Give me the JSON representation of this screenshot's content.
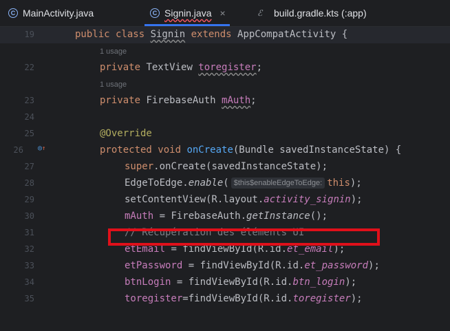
{
  "tabs": [
    {
      "label": "MainActivity.java",
      "icon": "c-class-icon",
      "active": false
    },
    {
      "label": "Signin.java",
      "icon": "c-class-icon",
      "active": true,
      "close": "×"
    },
    {
      "label": "build.gradle.kts (:app)",
      "icon": "gradle-icon",
      "active": false
    }
  ],
  "hints": {
    "usage_22": "1 usage",
    "usage_23": "1 usage"
  },
  "lines": {
    "n19": "19",
    "n22": "22",
    "n23": "23",
    "n24": "24",
    "n25": "25",
    "n26": "26",
    "n27": "27",
    "n28": "28",
    "n29": "29",
    "n30": "30",
    "n31": "31",
    "n32": "32",
    "n33": "33",
    "n34": "34",
    "n35": "35"
  },
  "code": {
    "l19_kw": "public class ",
    "l19_cls": "Signin",
    "l19_kw2": " extends ",
    "l19_rest": "AppCompatActivity {",
    "l22_kw": "private ",
    "l22_type": "TextView ",
    "l22_fld": "toregister",
    "l22_end": ";",
    "l23_kw": "private ",
    "l23_type": "FirebaseAuth ",
    "l23_fld": "mAuth",
    "l23_end": ";",
    "l25": "@Override",
    "l26_kw": "protected void ",
    "l26_fn": "onCreate",
    "l26_rest": "(Bundle savedInstanceState) {",
    "l27_kw": "super",
    "l27_rest": ".onCreate(savedInstanceState);",
    "l28_a": "EdgeToEdge.",
    "l28_fn": "enable",
    "l28_b": "(",
    "l28_hint": "$this$enableEdgeToEdge:",
    "l28_kw": "this",
    "l28_c": ");",
    "l29_a": "setContentView(R.layout.",
    "l29_f": "activity_signin",
    "l29_c": ");",
    "l30_f": "mAuth",
    "l30_a": " = FirebaseAuth.",
    "l30_fn": "getInstance",
    "l30_c": "();",
    "l31": "// Récupération des éléments UI",
    "l32_f": "etEmail",
    "l32_a": " = findViewById(R.id.",
    "l32_s": "et_email",
    "l32_c": ");",
    "l33_f": "etPassword",
    "l33_a": " = findViewById(R.id.",
    "l33_s": "et_password",
    "l33_c": ");",
    "l34_f": "btnLogin",
    "l34_a": " = findViewById(R.id.",
    "l34_s": "btn_login",
    "l34_c": ");",
    "l35_f": "toregister",
    "l35_a": "=findViewById(R.id.",
    "l35_s": "toregister",
    "l35_c": ");"
  },
  "colors": {
    "highlight_box": "#e0101a",
    "keyword": "#cf8e6d",
    "field": "#c77dbb",
    "method": "#56a8f5"
  }
}
